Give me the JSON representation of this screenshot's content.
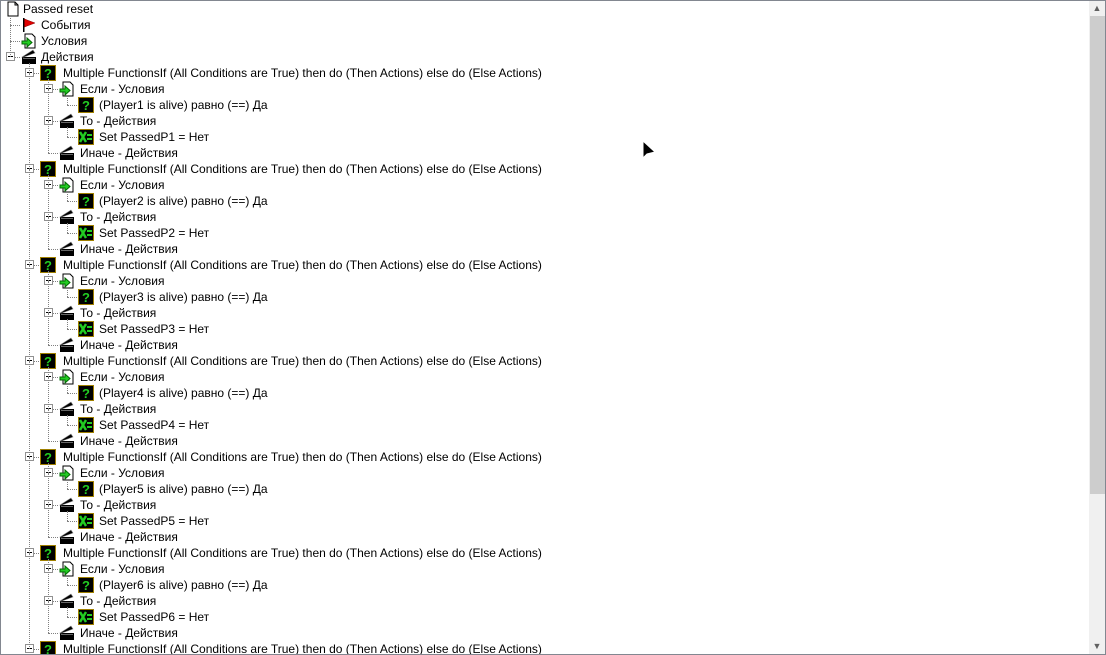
{
  "tree": {
    "root": "Passed reset",
    "events": "События",
    "conditions": "Условия",
    "actions": "Действия",
    "groups": [
      {
        "func": "Multiple FunctionsIf (All Conditions are True) then do (Then Actions) else do (Else Actions)",
        "if": "Если - Условия",
        "cond": "(Player1 is alive) равно (==) Да",
        "then": "То - Действия",
        "set": "Set PassedP1 = Нет",
        "else": "Иначе - Действия"
      },
      {
        "func": "Multiple FunctionsIf (All Conditions are True) then do (Then Actions) else do (Else Actions)",
        "if": "Если - Условия",
        "cond": "(Player2 is alive) равно (==) Да",
        "then": "То - Действия",
        "set": "Set PassedP2 = Нет",
        "else": "Иначе - Действия"
      },
      {
        "func": "Multiple FunctionsIf (All Conditions are True) then do (Then Actions) else do (Else Actions)",
        "if": "Если - Условия",
        "cond": "(Player3 is alive) равно (==) Да",
        "then": "То - Действия",
        "set": "Set PassedP3 = Нет",
        "else": "Иначе - Действия"
      },
      {
        "func": "Multiple FunctionsIf (All Conditions are True) then do (Then Actions) else do (Else Actions)",
        "if": "Если - Условия",
        "cond": "(Player4 is alive) равно (==) Да",
        "then": "То - Действия",
        "set": "Set PassedP4 = Нет",
        "else": "Иначе - Действия"
      },
      {
        "func": "Multiple FunctionsIf (All Conditions are True) then do (Then Actions) else do (Else Actions)",
        "if": "Если - Условия",
        "cond": "(Player5 is alive) равно (==) Да",
        "then": "То - Действия",
        "set": "Set PassedP5 = Нет",
        "else": "Иначе - Действия"
      },
      {
        "func": "Multiple FunctionsIf (All Conditions are True) then do (Then Actions) else do (Else Actions)",
        "if": "Если - Условия",
        "cond": "(Player6 is alive) равно (==) Да",
        "then": "То - Действия",
        "set": "Set PassedP6 = Нет",
        "else": "Иначе - Действия"
      },
      {
        "func": "Multiple FunctionsIf (All Conditions are True) then do (Then Actions) else do (Else Actions)"
      }
    ]
  },
  "colors": {
    "icon_green": "#22cc22",
    "flag_red": "#e00000",
    "icon_bg": "#000000"
  }
}
